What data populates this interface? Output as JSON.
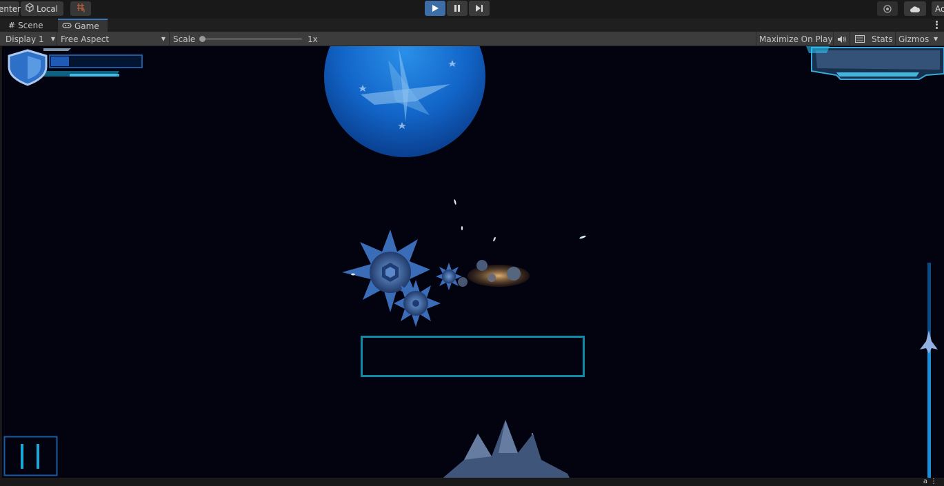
{
  "toolbar": {
    "pivot_label": "enter",
    "local_label": "Local",
    "account_label": "Ac"
  },
  "tabs": [
    {
      "label": "Scene",
      "icon": "hash-icon"
    },
    {
      "label": "Game",
      "icon": "gamepad-icon"
    }
  ],
  "controls": {
    "display": "Display 1",
    "aspect": "Free Aspect",
    "scale_label": "Scale",
    "scale_value": "1x",
    "maximize": "Maximize On Play",
    "stats": "Stats",
    "gizmos": "Gizmos"
  },
  "game": {
    "health_fill": 0.2,
    "progress_fill": 0.98
  },
  "colors": {
    "accent": "#3d6ea8",
    "hud_cyan": "#1a90b8",
    "space": "#02030f"
  }
}
